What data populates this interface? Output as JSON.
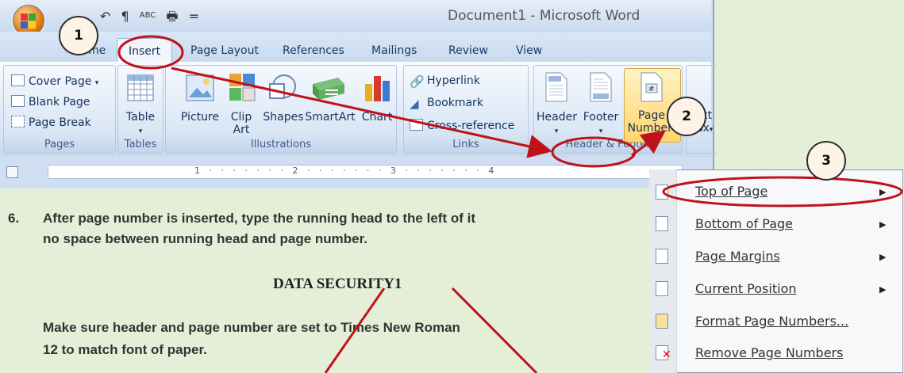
{
  "window": {
    "title": "Document1 - Microsoft Word",
    "qat_items": [
      "↶",
      "¶",
      "ABC",
      "🖶",
      "="
    ]
  },
  "tabs": [
    {
      "label": "Home"
    },
    {
      "label": "Insert"
    },
    {
      "label": "Page Layout"
    },
    {
      "label": "References"
    },
    {
      "label": "Mailings"
    },
    {
      "label": "Review"
    },
    {
      "label": "View"
    }
  ],
  "ribbon": {
    "pages": {
      "label": "Pages",
      "cover_page": "Cover Page",
      "blank_page": "Blank Page",
      "page_break": "Page Break"
    },
    "tables": {
      "label": "Tables",
      "table": "Table"
    },
    "illustrations": {
      "label": "Illustrations",
      "picture": "Picture",
      "clip_art_1": "Clip",
      "clip_art_2": "Art",
      "shapes": "Shapes",
      "smartart": "SmartArt",
      "chart": "Chart"
    },
    "links": {
      "label": "Links",
      "hyperlink": "Hyperlink",
      "bookmark": "Bookmark",
      "cross_reference": "Cross-reference"
    },
    "header_footer": {
      "label": "Header & Footer",
      "header": "Header",
      "footer": "Footer",
      "page_number_1": "Page",
      "page_number_2": "Number"
    },
    "text": {
      "text_box_1": "Text",
      "text_box_2": "Box"
    }
  },
  "ruler": {
    "ticks": "1 · · · · · · · 2 · · · · · · · 3 · · · · · · · 4"
  },
  "menu": {
    "items": [
      {
        "label": "Top of Page",
        "has_submenu": true
      },
      {
        "label": "Bottom of Page",
        "has_submenu": true
      },
      {
        "label": "Page Margins",
        "has_submenu": true
      },
      {
        "label": "Current Position",
        "has_submenu": true
      },
      {
        "label": "Format Page Numbers...",
        "has_submenu": false
      },
      {
        "label": "Remove Page Numbers",
        "has_submenu": false
      }
    ]
  },
  "annotations": {
    "step1": "1",
    "step2": "2",
    "step3": "3"
  },
  "instructions": {
    "step_num": "6.",
    "step_line1": "After page number is inserted, type the running head to the left of it",
    "step_line2": "no space between running head and page number.",
    "example": "DATA SECURITY1",
    "note_line1": "Make sure header and page number are set to Times New Roman",
    "note_line2": "12 to match font of paper."
  },
  "colors": {
    "accent_red": "#c0121a",
    "highlight": "#ffd56b"
  }
}
